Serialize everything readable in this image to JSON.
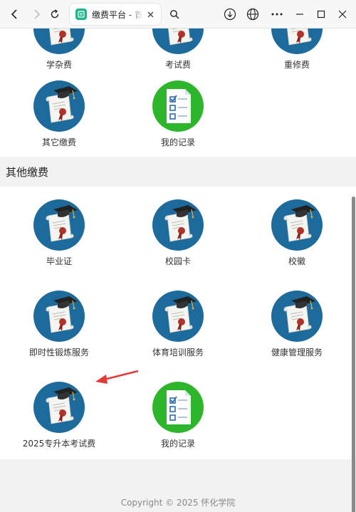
{
  "browser": {
    "tab_title": "缴费平台 - 首页"
  },
  "top_row": [
    {
      "label": "学杂费"
    },
    {
      "label": "考试费"
    },
    {
      "label": "重修费"
    }
  ],
  "row2": [
    {
      "label": "其它缴费"
    },
    {
      "label": "我的记录"
    }
  ],
  "other_section": {
    "title": "其他缴费",
    "items": [
      {
        "label": "毕业证"
      },
      {
        "label": "校园卡"
      },
      {
        "label": "校徽"
      },
      {
        "label": "即时性锻炼服务"
      },
      {
        "label": "体育培训服务"
      },
      {
        "label": "健康管理服务"
      },
      {
        "label": "2025专升本考试费"
      },
      {
        "label": "我的记录"
      }
    ]
  },
  "footer": {
    "text": "Copyright © 2025  怀化学院"
  },
  "colors": {
    "icon_blue": "#1d6a9c",
    "icon_green": "#2db52b",
    "arrow_red": "#e53935"
  }
}
